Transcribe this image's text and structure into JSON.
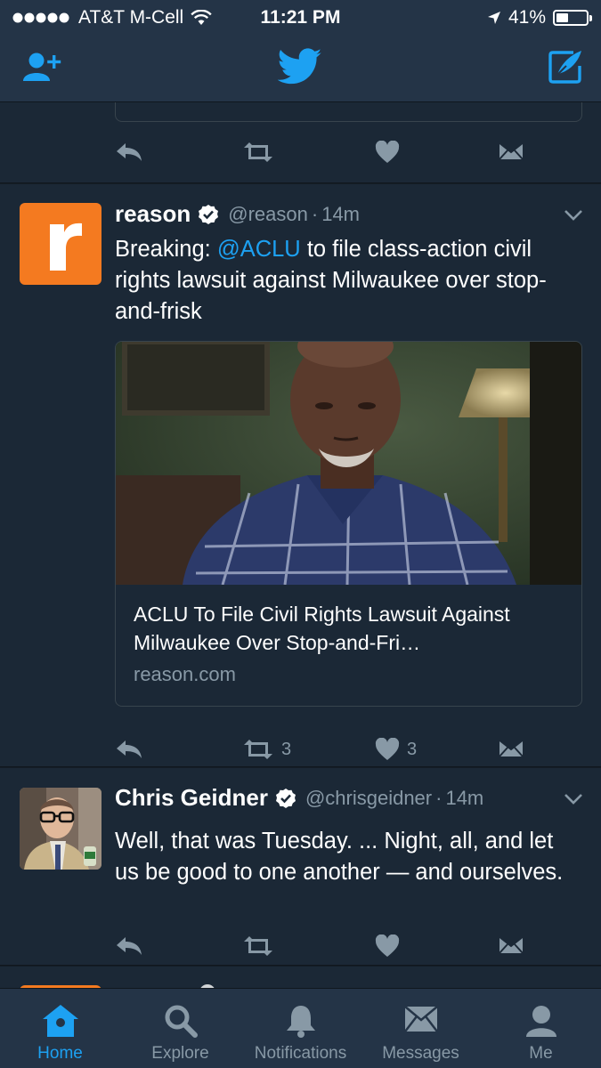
{
  "status_bar": {
    "carrier": "AT&T M-Cell",
    "time": "11:21 PM",
    "battery": "41%",
    "battery_level": 0.41
  },
  "header": {
    "add_user_icon": "add-user-icon",
    "logo_icon": "twitter-bird-icon",
    "compose_icon": "compose-tweet-icon"
  },
  "tweets": [
    {
      "name": "reason",
      "handle": "@reason",
      "time": "14m",
      "text_prefix": "Breaking: ",
      "mention": "@ACLU",
      "text_suffix": " to file class-action civil rights lawsuit against Milwaukee over stop-and-frisk",
      "card": {
        "title": "ACLU To File Civil Rights Lawsuit Against Milwaukee Over Stop-and-Fri…",
        "domain": "reason.com"
      },
      "retweets": "3",
      "likes": "3"
    },
    {
      "name": "Chris Geidner",
      "handle": "@chrisgeidner",
      "time": "14m",
      "text": "Well, that was Tuesday. ... Night, all, and let us be good to one another — and ourselves."
    }
  ],
  "tabs": [
    {
      "label": "Home",
      "icon": "home-icon",
      "active": true
    },
    {
      "label": "Explore",
      "icon": "search-icon"
    },
    {
      "label": "Notifications",
      "icon": "bell-icon"
    },
    {
      "label": "Messages",
      "icon": "envelope-icon"
    },
    {
      "label": "Me",
      "icon": "person-icon"
    }
  ],
  "colors": {
    "accent": "#1da1f2",
    "background": "#141d26",
    "tweet_bg": "#1b2836",
    "bar_bg": "#243447",
    "muted": "#8899a6",
    "reason_orange": "#f47a20"
  }
}
